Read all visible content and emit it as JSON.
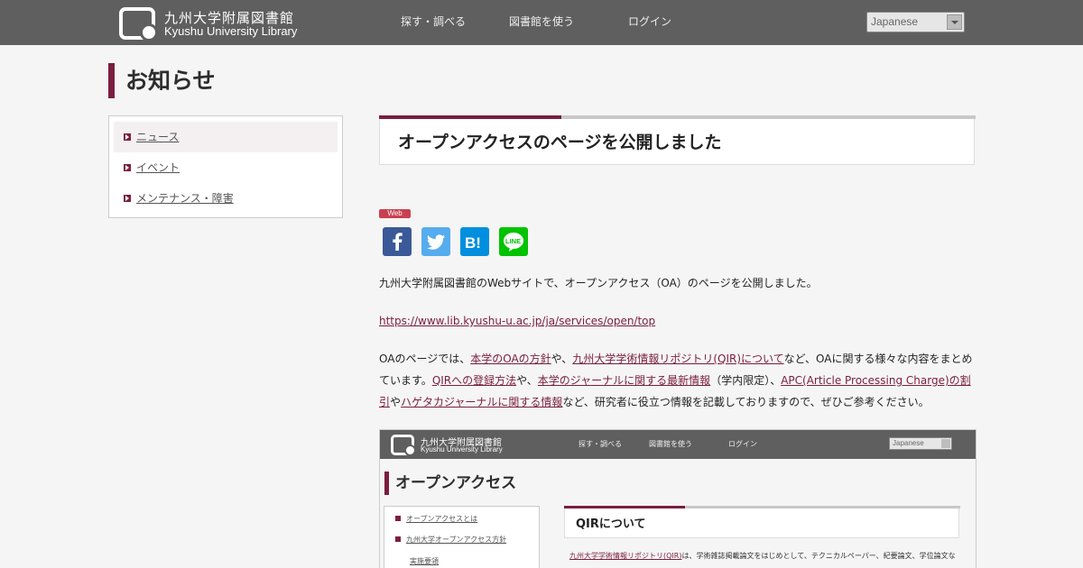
{
  "header": {
    "logo_ja": "九州大学附属図書館",
    "logo_en": "Kyushu University Library",
    "nav": [
      "探す・調べる",
      "図書館を使う",
      "ログイン"
    ],
    "language": "Japanese"
  },
  "page_title": "お知らせ",
  "sidebar": {
    "items": [
      {
        "label": "ニュース"
      },
      {
        "label": "イベント"
      },
      {
        "label": "メンテナンス・障害"
      }
    ]
  },
  "article": {
    "title": "オープンアクセスのページを公開しました",
    "tag": "Web",
    "share": [
      "facebook-icon",
      "twitter-icon",
      "hatena-bookmark-icon",
      "line-icon"
    ],
    "intro": "九州大学附属図書館のWebサイトで、オープンアクセス（OA）のページを公開しました。",
    "url": "https://www.lib.kyushu-u.ac.jp/ja/services/open/top",
    "body": {
      "t1": "OAのページでは、",
      "l1": "本学のOAの方針",
      "t2": "や、",
      "l2": "九州大学学術情報リポジトリ(QIR)について",
      "t3": "など、OAに関する様々な内容をまとめ",
      "t4": "ています。",
      "l3": "QIRへの登録方法",
      "t5": "や、",
      "l4": "本学のジャーナルに関する最新情報",
      "t6": "（学内限定）、",
      "l5a": "APC(Article Processing Charge)の割",
      "l5b": "引",
      "t7": "や",
      "l6": "ハゲタカジャーナルに関する情報",
      "t8": "など、研究者に役立つ情報を記載しておりますので、ぜひご参考ください。"
    },
    "screenshot": {
      "logo_ja": "九州大学附属図書館",
      "logo_en": "Kyushu University Library",
      "nav": [
        "探す・調べる",
        "図書館を使う",
        "ログイン"
      ],
      "language": "Japanese",
      "title": "オープンアクセス",
      "side": [
        "オープンアクセスとは",
        "九州大学オープンアクセス方針",
        "実施要領"
      ],
      "heading": "QIRについて",
      "body_link": "九州大学学術情報リポジトリ(QIR)",
      "body_text": "は、学術雑誌掲載論文をはじめとして、テクニカルペーパー、紀要論文、学位論文な"
    }
  },
  "colors": {
    "accent": "#7a1e3f",
    "header": "#5f5f5f",
    "tag": "#c9414f"
  }
}
